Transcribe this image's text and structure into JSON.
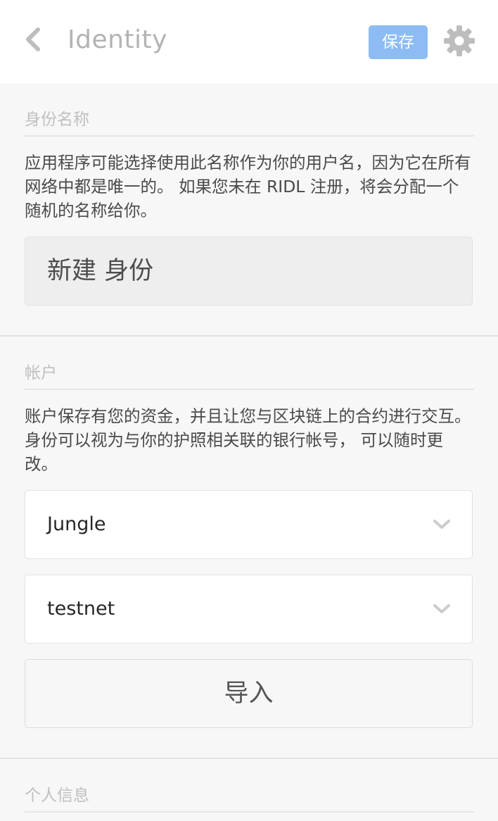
{
  "header": {
    "title": "Identity",
    "save_label": "保存"
  },
  "identity_name_section": {
    "title": "身份名称",
    "description": "应用程序可能选择使用此名称作为你的用户名，因为它在所有网络中都是唯一的。 如果您未在 RIDL 注册，将会分配一个随机的名称给你。",
    "name_value": "新建 身份"
  },
  "account_section": {
    "title": "帐户",
    "description": "账户保存有您的资金，并且让您与区块链上的合约进行交互。 身份可以视为与你的护照相关联的银行帐号， 可以随时更改。",
    "network_select": "Jungle",
    "account_select": "testnet",
    "import_label": "导入"
  },
  "personal_info_section": {
    "title": "个人信息"
  },
  "colors": {
    "accent": "#8cbcf3",
    "header_bg": "#ffffff",
    "page_bg": "#f7f7f7"
  }
}
